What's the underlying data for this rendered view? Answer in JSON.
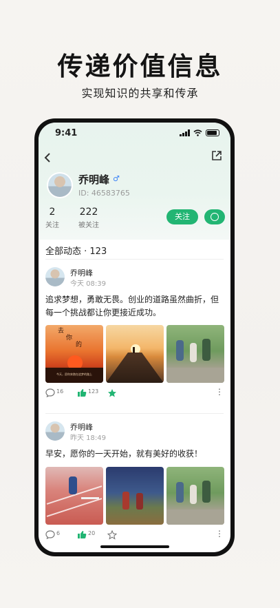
{
  "hero": {
    "title": "传递价值信息",
    "subtitle": "实现知识的共享和传承"
  },
  "status_bar": {
    "time": "9:41"
  },
  "profile": {
    "name": "乔明峰",
    "gender_symbol": "♂",
    "user_id": "ID: 46583765",
    "following_count": "2",
    "following_label": "关注",
    "followers_count": "222",
    "followers_label": "被关注",
    "follow_button": "关注"
  },
  "feed": {
    "section_title": "全部动态 · 123",
    "posts": [
      {
        "author": "乔明峰",
        "time": "今天 08:39",
        "text": "追求梦想，勇敢无畏。创业的道路虽然曲折，但每一个挑战都让你更接近成功。",
        "comments": "16",
        "likes": "123",
        "starred": true
      },
      {
        "author": "乔明峰",
        "time": "昨天 18:49",
        "text": "早安，愿你的一天开始，就有美好的收获！",
        "comments": "6",
        "likes": "20",
        "starred": false
      }
    ]
  },
  "poster_image_text": {
    "line1": "去",
    "line2": "你",
    "line3": "的",
    "caption": "今天，愿你奔跑在追梦的路上"
  },
  "colors": {
    "accent": "#22b573",
    "gender": "#3b82f6"
  }
}
